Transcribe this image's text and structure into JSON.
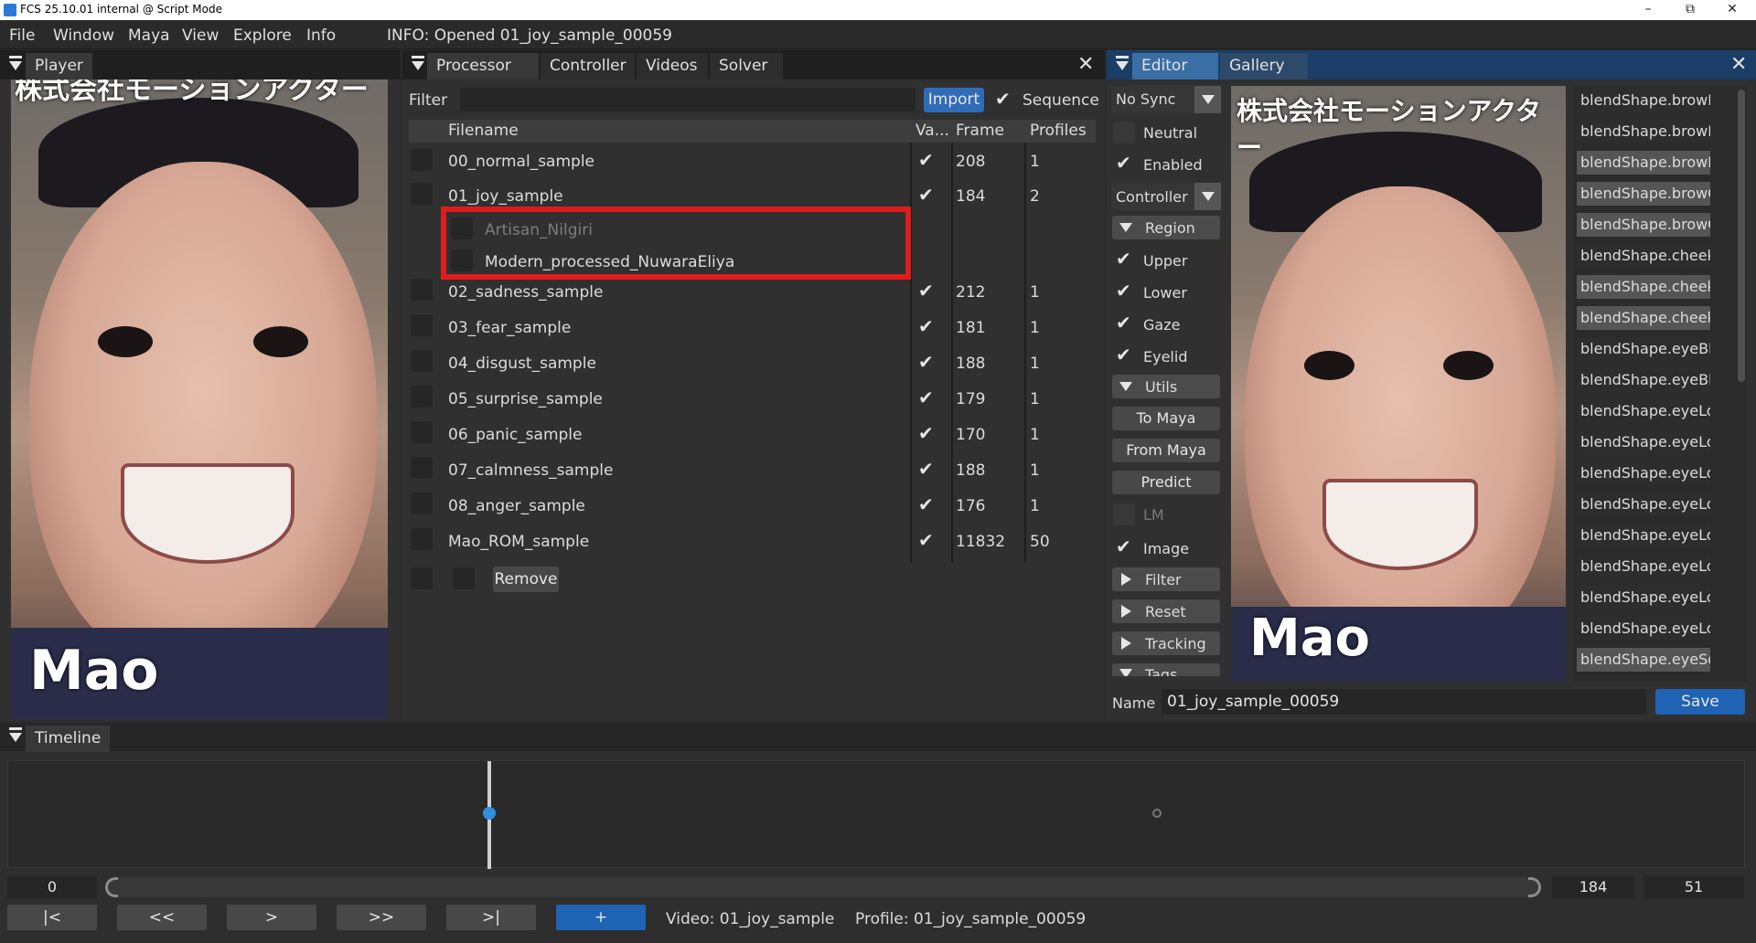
{
  "window": {
    "title": "FCS 25.10.01 internal @ Script Mode",
    "minimize": "–",
    "maximize": "⧉",
    "close": "✕"
  },
  "menu": {
    "items": [
      "File",
      "Window",
      "Maya",
      "View",
      "Explore",
      "Info"
    ],
    "info_text": "INFO: Opened 01_joy_sample_00059"
  },
  "player": {
    "tab": "Player",
    "banner_text": "株式会社モーションアクター",
    "name_overlay": "Mao"
  },
  "processor": {
    "tabs": [
      "Processor",
      "Controller",
      "Videos",
      "Solver"
    ],
    "filter_label": "Filter",
    "filter_value": "",
    "import_label": "Import",
    "sequence_label": "Sequence",
    "sequence_checked": true,
    "columns": [
      "Filename",
      "Va...",
      "Frame",
      "Profiles"
    ],
    "rows": [
      {
        "filename": "00_normal_sample",
        "valid": true,
        "frame": "208",
        "profiles": "1"
      },
      {
        "filename": "01_joy_sample",
        "valid": true,
        "frame": "184",
        "profiles": "2"
      },
      {
        "filename": "Artisan_Nilgiri",
        "child": true,
        "dimmed": true
      },
      {
        "filename": "Modern_processed_NuwaraEliya",
        "child": true
      },
      {
        "filename": "02_sadness_sample",
        "valid": true,
        "frame": "212",
        "profiles": "1"
      },
      {
        "filename": "03_fear_sample",
        "valid": true,
        "frame": "181",
        "profiles": "1"
      },
      {
        "filename": "04_disgust_sample",
        "valid": true,
        "frame": "188",
        "profiles": "1"
      },
      {
        "filename": "05_surprise_sample",
        "valid": true,
        "frame": "179",
        "profiles": "1"
      },
      {
        "filename": "06_panic_sample",
        "valid": true,
        "frame": "170",
        "profiles": "1"
      },
      {
        "filename": "07_calmness_sample",
        "valid": true,
        "frame": "188",
        "profiles": "1"
      },
      {
        "filename": "08_anger_sample",
        "valid": true,
        "frame": "176",
        "profiles": "1"
      },
      {
        "filename": "Mao_ROM_sample",
        "valid": true,
        "frame": "11832",
        "profiles": "50"
      }
    ],
    "remove_label": "Remove",
    "highlight_color": "#e01b1b"
  },
  "editor": {
    "tabs": [
      "Editor",
      "Gallery"
    ],
    "sync_value": "No Sync",
    "neutral": "Neutral",
    "enabled": "Enabled",
    "controller_value": "Controller",
    "region": "Region",
    "upper": "Upper",
    "lower": "Lower",
    "gaze": "Gaze",
    "eyelid": "Eyelid",
    "utils": "Utils",
    "to_maya": "To Maya",
    "from_maya": "From Maya",
    "predict": "Predict",
    "lm": "LM",
    "image": "Image",
    "filter": "Filter",
    "reset": "Reset",
    "tracking": "Tracking",
    "tags": "Tags",
    "banner_text": "株式会社モーションアクター",
    "name_overlay": "Mao",
    "blendshapes": [
      {
        "label": "blendShape.browDow",
        "hl": false
      },
      {
        "label": "blendShape.browDow",
        "hl": false
      },
      {
        "label": "blendShape.browInne",
        "hl": true
      },
      {
        "label": "blendShape.browOut",
        "hl": true
      },
      {
        "label": "blendShape.browOut",
        "hl": true
      },
      {
        "label": "blendShape.cheekPu",
        "hl": false
      },
      {
        "label": "blendShape.cheekSq",
        "hl": true
      },
      {
        "label": "blendShape.cheekSq",
        "hl": true
      },
      {
        "label": "blendShape.eyeBlink",
        "hl": false
      },
      {
        "label": "blendShape.eyeBlink",
        "hl": false
      },
      {
        "label": "blendShape.eyeLook",
        "hl": false
      },
      {
        "label": "blendShape.eyeLook",
        "hl": false
      },
      {
        "label": "blendShape.eyeLook",
        "hl": false
      },
      {
        "label": "blendShape.eyeLook",
        "hl": false
      },
      {
        "label": "blendShape.eyeLook",
        "hl": false
      },
      {
        "label": "blendShape.eyeLook",
        "hl": false
      },
      {
        "label": "blendShape.eyeLook",
        "hl": false
      },
      {
        "label": "blendShape.eyeLook",
        "hl": false
      },
      {
        "label": "blendShape.eyeSquin",
        "hl": true
      }
    ],
    "name_label": "Name",
    "name_value": "01_joy_sample_00059",
    "save_label": "Save"
  },
  "timeline": {
    "tab": "Timeline",
    "start_value": "0",
    "end_value": "184",
    "current_value": "51",
    "buttons": {
      "first": "|<",
      "prev": "<<",
      "play": ">",
      "next": ">>",
      "last": ">|",
      "add": "+"
    },
    "video_text": "Video:  01_joy_sample",
    "profile_text": "Profile:  01_joy_sample_00059",
    "playhead_fraction": 0.277,
    "key_marker_fraction": 0.663
  }
}
